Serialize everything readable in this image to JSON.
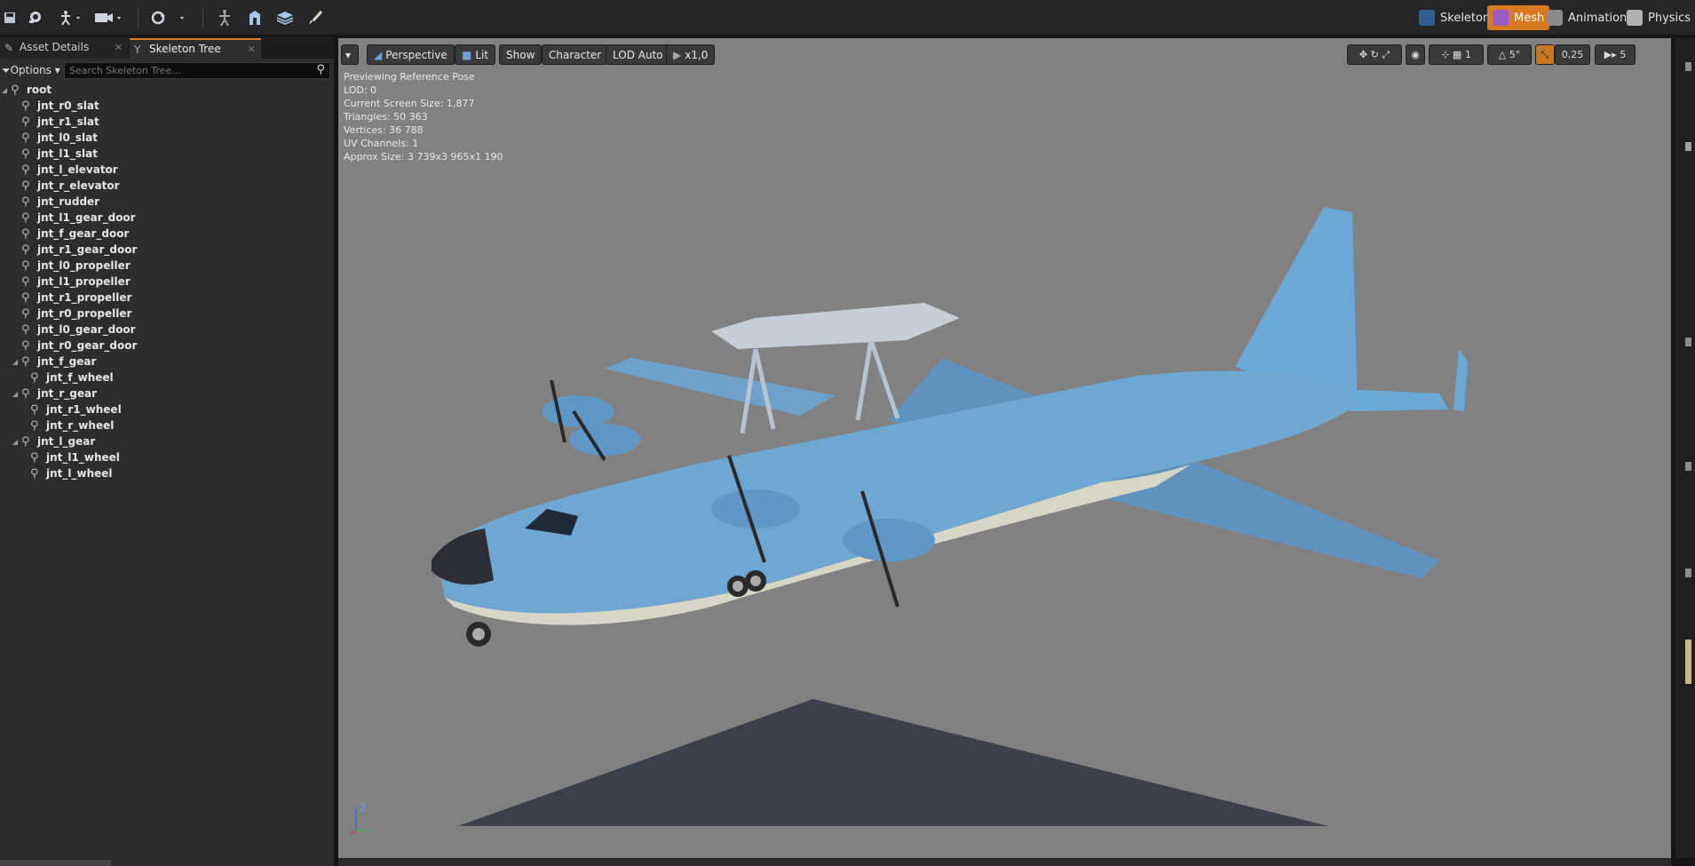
{
  "toolbar": {
    "icons": [
      "save-icon",
      "find-icon",
      "anim-pose-icon",
      "camera-icon",
      "reimport-icon",
      "bone-icon",
      "mesh-icon",
      "layers-icon",
      "brush-icon"
    ],
    "modes": [
      {
        "label": "Skeleton",
        "icon": "skeleton-icon"
      },
      {
        "label": "Mesh",
        "icon": "mesh-mode-icon",
        "active": true
      },
      {
        "label": "Animation",
        "icon": "animation-icon"
      },
      {
        "label": "Physics",
        "icon": "physics-icon"
      }
    ]
  },
  "tabs": [
    {
      "label": "Asset Details"
    },
    {
      "label": "Skeleton Tree",
      "active": true
    }
  ],
  "skeleton_tree": {
    "options_label": "Options",
    "search_placeholder": "Search Skeleton Tree...",
    "nodes": [
      {
        "label": "root",
        "depth": 0,
        "expandable": true
      },
      {
        "label": "jnt_r0_slat",
        "depth": 1
      },
      {
        "label": "jnt_r1_slat",
        "depth": 1
      },
      {
        "label": "jnt_l0_slat",
        "depth": 1
      },
      {
        "label": "jnt_l1_slat",
        "depth": 1
      },
      {
        "label": "jnt_l_elevator",
        "depth": 1
      },
      {
        "label": "jnt_r_elevator",
        "depth": 1
      },
      {
        "label": "jnt_rudder",
        "depth": 1
      },
      {
        "label": "jnt_l1_gear_door",
        "depth": 1
      },
      {
        "label": "jnt_f_gear_door",
        "depth": 1
      },
      {
        "label": "jnt_r1_gear_door",
        "depth": 1
      },
      {
        "label": "jnt_l0_propeller",
        "depth": 1
      },
      {
        "label": "jnt_l1_propeller",
        "depth": 1
      },
      {
        "label": "jnt_r1_propeller",
        "depth": 1
      },
      {
        "label": "jnt_r0_propeller",
        "depth": 1
      },
      {
        "label": "jnt_l0_gear_door",
        "depth": 1
      },
      {
        "label": "jnt_r0_gear_door",
        "depth": 1
      },
      {
        "label": "jnt_f_gear",
        "depth": 1,
        "expandable": true
      },
      {
        "label": "jnt_f_wheel",
        "depth": 2
      },
      {
        "label": "jnt_r_gear",
        "depth": 1,
        "expandable": true
      },
      {
        "label": "jnt_r1_wheel",
        "depth": 2
      },
      {
        "label": "jnt_r_wheel",
        "depth": 2
      },
      {
        "label": "jnt_l_gear",
        "depth": 1,
        "expandable": true
      },
      {
        "label": "jnt_l1_wheel",
        "depth": 2
      },
      {
        "label": "jnt_l_wheel",
        "depth": 2
      }
    ]
  },
  "viewport": {
    "buttons": {
      "perspective": "Perspective",
      "lit": "Lit",
      "show": "Show",
      "character": "Character",
      "lod": "LOD Auto",
      "speed": "x1,0"
    },
    "right_controls": {
      "rotation_snap": "5°",
      "scale_snap": "0,25",
      "camera_speed": "5"
    },
    "stats": [
      "Previewing Reference Pose",
      "LOD: 0",
      "Current Screen Size: 1,877",
      "Triangles: 50 363",
      "Vertices: 36 788",
      "UV Channels: 1",
      "Approx Size: 3 739x3 965x1 190"
    ],
    "axis_label": "Z"
  }
}
